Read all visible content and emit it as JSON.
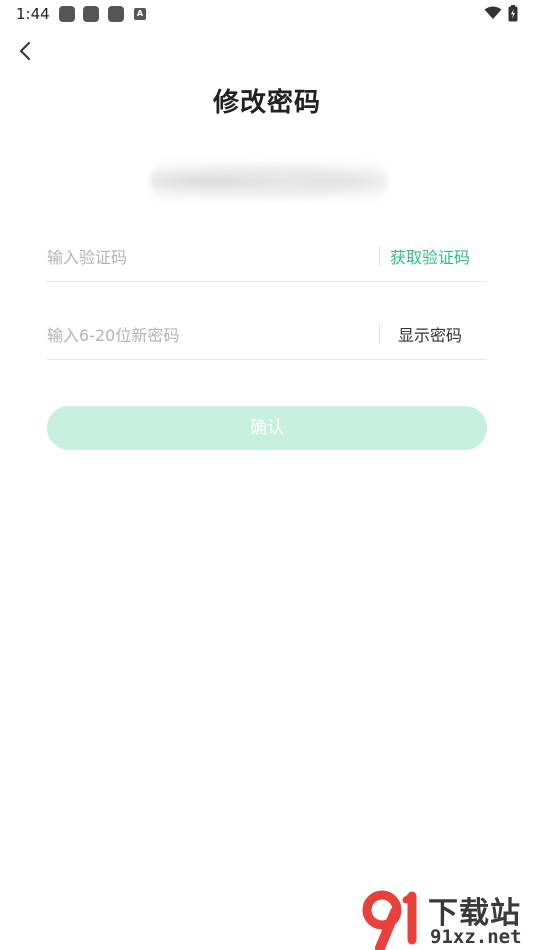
{
  "status_bar": {
    "time": "1:44",
    "notification_icons": [
      "app-notification-icon",
      "app-notification-icon",
      "app-notification-icon",
      "a-notification-icon"
    ],
    "a_icon_label": "A",
    "wifi_icon": "wifi-icon",
    "battery_icon": "battery-charging-icon"
  },
  "header": {
    "back_icon": "chevron-left-icon",
    "title": "修改密码"
  },
  "form": {
    "code_placeholder": "输入验证码",
    "get_code_label": "获取验证码",
    "password_placeholder": "输入6-20位新密码",
    "show_password_label": "显示密码",
    "confirm_label": "确认"
  },
  "watermark": {
    "title": "下载站",
    "domain": "91xz.net"
  },
  "colors": {
    "accent": "#2fbf7f",
    "confirm_disabled_bg": "#c6efe0",
    "placeholder": "#b4b4b4",
    "watermark_red": "#e8413c"
  }
}
